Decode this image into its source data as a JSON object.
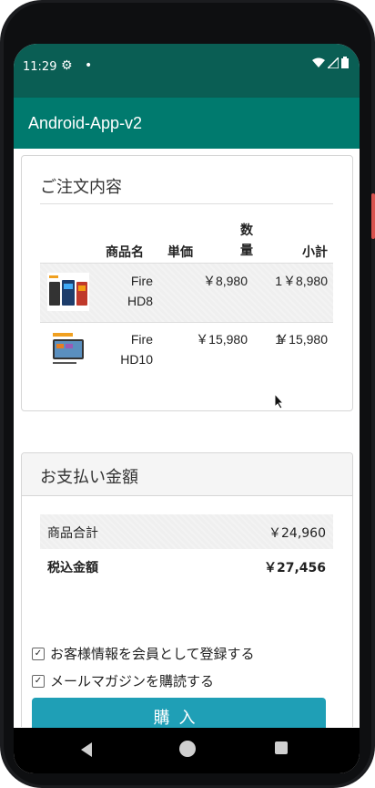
{
  "status_bar": {
    "time": "11:29",
    "icons": [
      "gear-icon",
      "dot-icon",
      "wifi-icon",
      "signal-icon",
      "battery-icon"
    ]
  },
  "app_bar": {
    "title": "Android-App-v2"
  },
  "order": {
    "title": "ご注文内容",
    "headers": {
      "name": "商品名",
      "price": "単価",
      "qty": "数量",
      "subtotal": "小計"
    },
    "rows": [
      {
        "name_line1": "Fire",
        "name_line2": "HD8",
        "price": "￥8,980",
        "qty": "1",
        "subtotal": "￥8,980"
      },
      {
        "name_line1": "Fire",
        "name_line2": "HD10",
        "price": "￥15,980",
        "qty": "1",
        "subtotal": "￥15,980"
      }
    ]
  },
  "payment": {
    "title": "お支払い金額",
    "items_total_label": "商品合計",
    "items_total_value": "￥24,960",
    "tax_total_label": "税込金額",
    "tax_total_value": "￥27,456"
  },
  "options": {
    "register_member_label": "お客様情報を会員として登録する",
    "register_member_checked": true,
    "newsletter_label": "メールマガジンを購読する",
    "newsletter_checked": true
  },
  "purchase_button": {
    "label": "購入"
  },
  "colors": {
    "status_bar": "#0a5e54",
    "app_bar": "#007a6e",
    "button": "#1f9fb6"
  }
}
